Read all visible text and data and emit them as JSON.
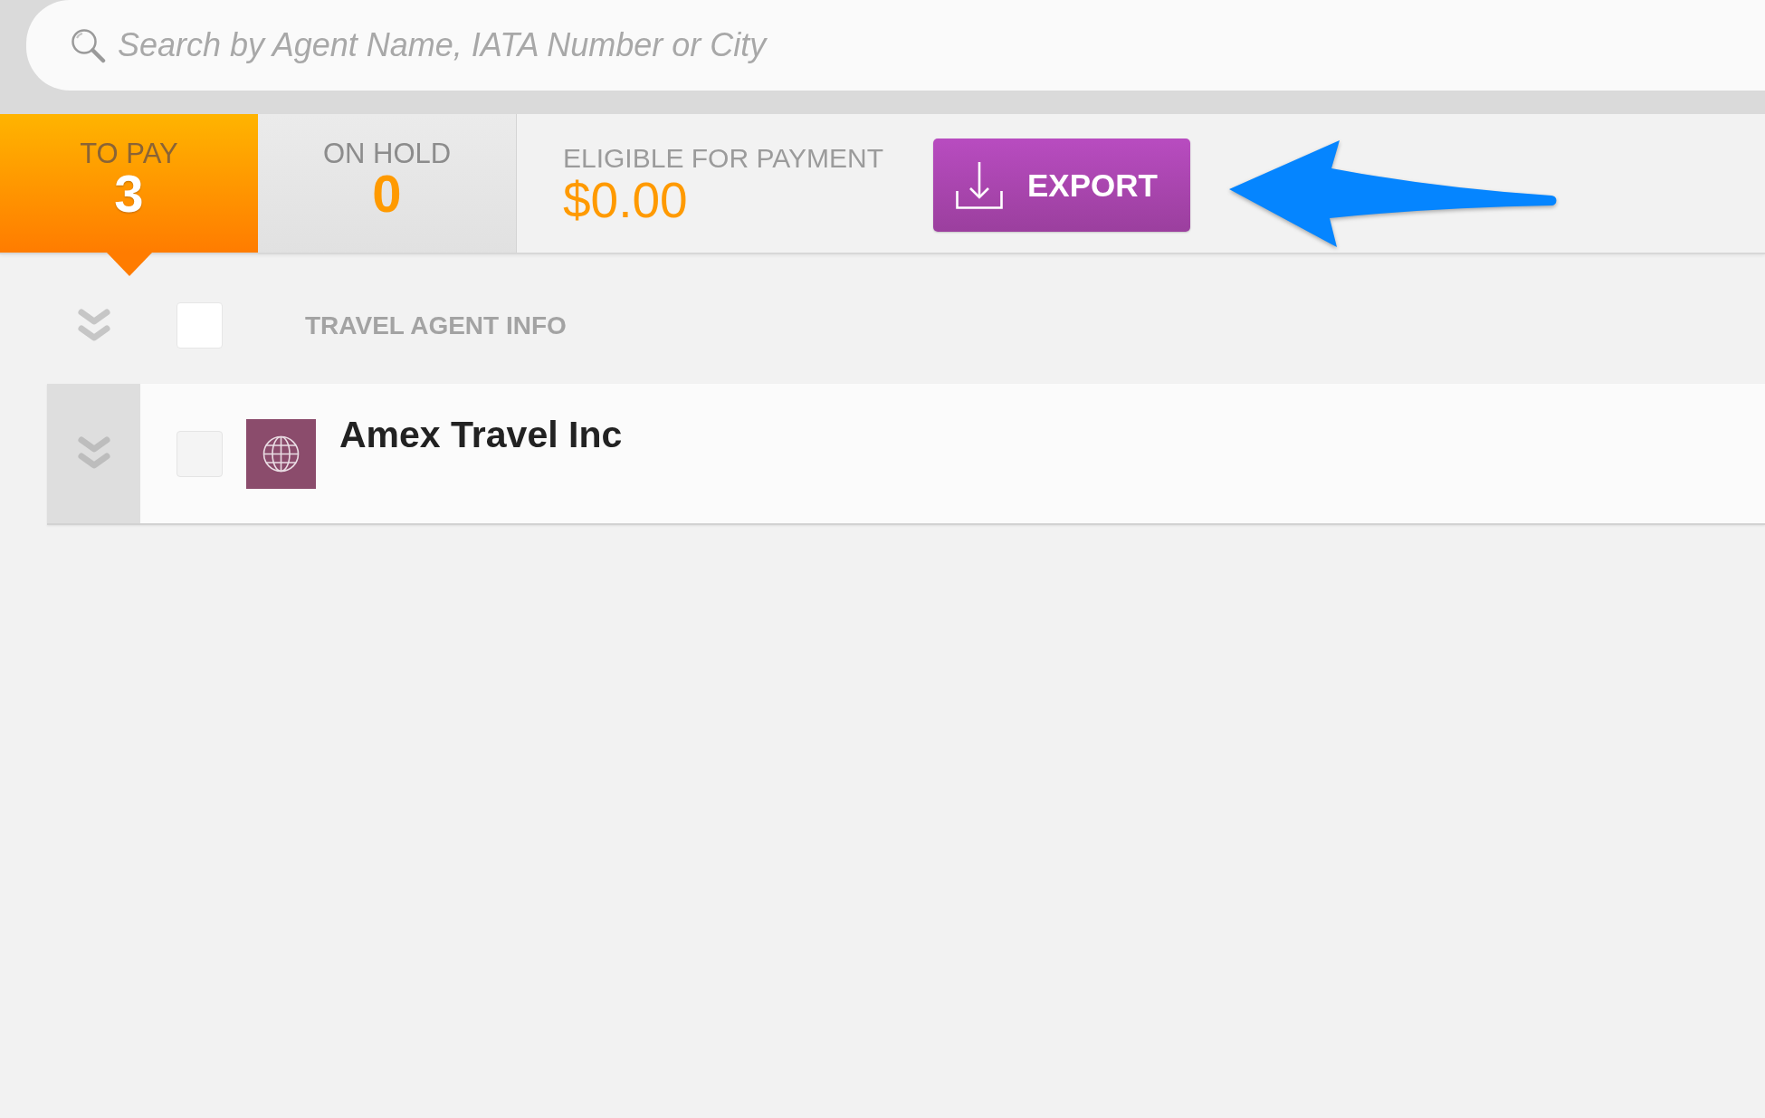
{
  "search": {
    "placeholder": "Search by Agent Name, IATA Number or City"
  },
  "tabs": [
    {
      "label": "TO PAY",
      "count": "3",
      "selected": true
    },
    {
      "label": "ON HOLD",
      "count": "0",
      "selected": false
    }
  ],
  "summary": {
    "label": "ELIGIBLE FOR PAYMENT",
    "amount": "$0.00"
  },
  "export_button": {
    "label": "EXPORT"
  },
  "table": {
    "header": {
      "label": "TRAVEL AGENT INFO",
      "checked": false
    },
    "rows": [
      {
        "name": "Amex Travel Inc",
        "checked": false
      }
    ]
  }
}
